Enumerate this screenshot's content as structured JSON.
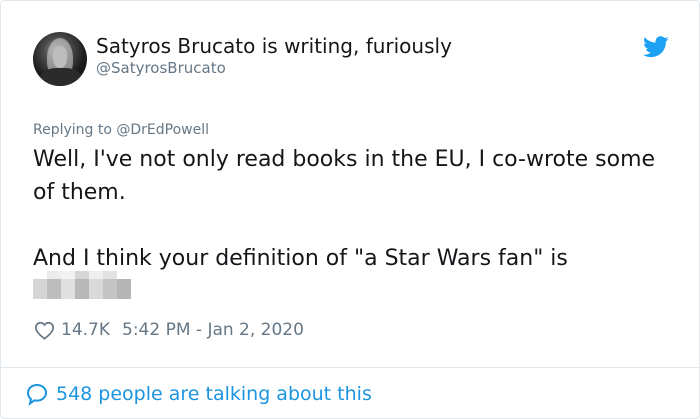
{
  "user": {
    "name": "Satyros Brucato is writing, furiously",
    "handle": "@SatyrosBrucato"
  },
  "reply_to": "Replying to @DrEdPowell",
  "tweet": {
    "paragraph1": "Well, I've not only read books in the EU, I co-wrote some of them.",
    "paragraph2": "And I think your definition of \"a Star Wars fan\" is"
  },
  "meta": {
    "likes": "14.7K",
    "timestamp": "5:42 PM - Jan 2, 2020"
  },
  "footer": {
    "talking": "548 people are talking about this"
  },
  "icons": {
    "brand": "twitter-bird-icon",
    "like": "heart-icon",
    "reply": "speech-bubble-icon"
  },
  "colors": {
    "twitter_blue": "#1da1f2",
    "link_blue": "#1b95e0",
    "secondary_text": "#657786",
    "primary_text": "#14171a"
  }
}
